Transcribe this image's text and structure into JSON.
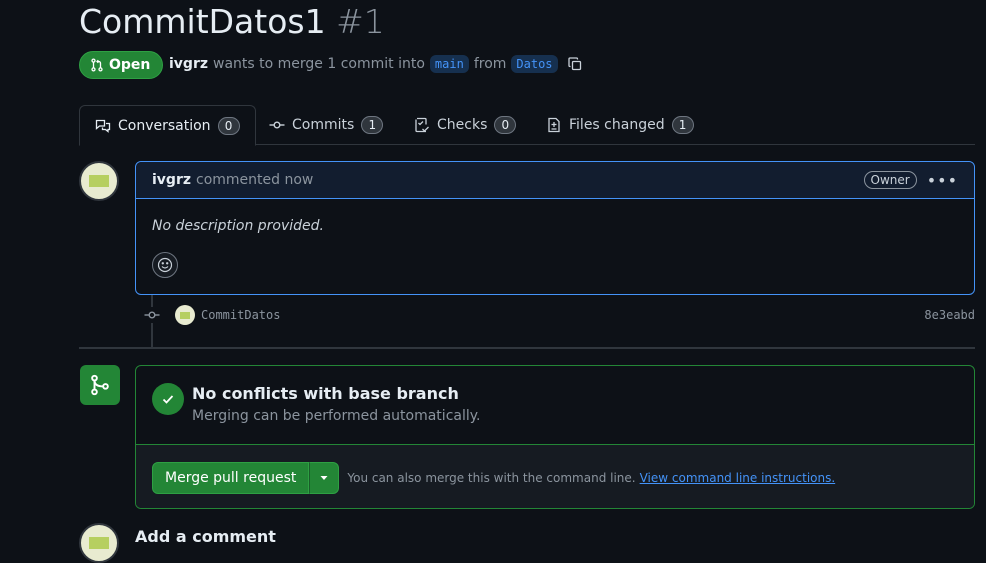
{
  "pr": {
    "title": "CommitDatos1",
    "number": "#1",
    "state_label": "Open",
    "author": "ivgrz",
    "merge_text": "wants to merge 1 commit into",
    "base_branch": "main",
    "from_text": "from",
    "head_branch": "Datos"
  },
  "tabs": [
    {
      "label": "Conversation",
      "count": "0",
      "icon": "comment-discussion-icon"
    },
    {
      "label": "Commits",
      "count": "1",
      "icon": "git-commit-icon"
    },
    {
      "label": "Checks",
      "count": "0",
      "icon": "checklist-icon"
    },
    {
      "label": "Files changed",
      "count": "1",
      "icon": "file-diff-icon"
    }
  ],
  "comment": {
    "author": "ivgrz",
    "action": "commented now",
    "badge": "Owner",
    "body": "No description provided."
  },
  "commit": {
    "message": "CommitDatos",
    "sha": "8e3eabd"
  },
  "merge": {
    "title": "No conflicts with base branch",
    "subtitle": "Merging can be performed automatically.",
    "button": "Merge pull request",
    "hint": "You can also merge this with the command line.",
    "link": "View command line instructions."
  },
  "add_comment": {
    "title": "Add a comment"
  },
  "colors": {
    "background": "#0d1117",
    "accent_green": "#238636",
    "accent_blue": "#4493f8"
  }
}
